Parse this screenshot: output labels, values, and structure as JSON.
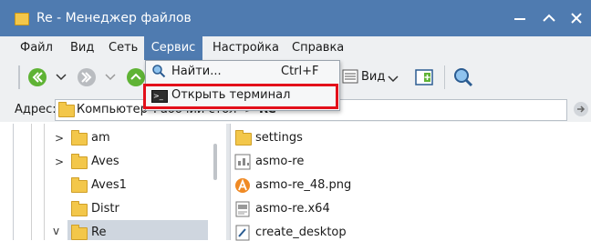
{
  "window": {
    "title": "Re - Менеджер файлов"
  },
  "menubar": {
    "items": [
      "Файл",
      "Вид",
      "Сеть",
      "Сервис",
      "Настройка",
      "Справка"
    ]
  },
  "service_menu": {
    "items": [
      {
        "label": "Найти...",
        "shortcut": "Ctrl+F",
        "icon": "search-icon"
      },
      {
        "label": "Открыть терминал",
        "shortcut": "",
        "icon": "terminal-icon"
      }
    ]
  },
  "toolbar": {
    "view_label": "Вид"
  },
  "address": {
    "label": "Адрес:",
    "path_root": "Компьютер",
    "path_rest": "Рабочий стол",
    "path_last": "Re"
  },
  "tree": {
    "items": [
      "am",
      "Aves",
      "Aves1",
      "Distr",
      "Re"
    ]
  },
  "files": {
    "items": [
      {
        "name": "settings",
        "icon": "folder-icon"
      },
      {
        "name": "asmo-re",
        "icon": "executable-icon"
      },
      {
        "name": "asmo-re_48.png",
        "icon": "image-icon"
      },
      {
        "name": "asmo-re.x64",
        "icon": "binary-icon"
      },
      {
        "name": "create_desktop",
        "icon": "script-icon"
      }
    ]
  },
  "colors": {
    "titlebar": "#4f7bb0",
    "highlight": "#e3101a",
    "green_button": "#5fb335"
  }
}
